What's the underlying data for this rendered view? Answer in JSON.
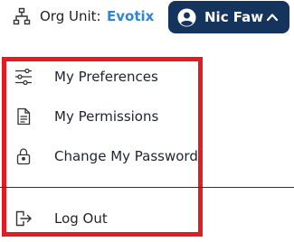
{
  "header": {
    "org_label": "Org Unit:",
    "org_value": "Evotix",
    "org_icon": "org-hierarchy-icon",
    "user_name": "Nic Faw",
    "user_icon": "user-avatar-icon",
    "chevron_icon": "chevron-up-icon",
    "colors": {
      "brand_navy": "#14345e",
      "org_link": "#2f86d6",
      "highlight": "#e31b23"
    }
  },
  "menu": {
    "items": [
      {
        "label": "My Preferences",
        "icon": "sliders-icon"
      },
      {
        "label": "My Permissions",
        "icon": "document-icon"
      },
      {
        "label": "Change My Password",
        "icon": "lock-icon"
      },
      {
        "label": "Log Out",
        "icon": "logout-icon"
      }
    ]
  }
}
